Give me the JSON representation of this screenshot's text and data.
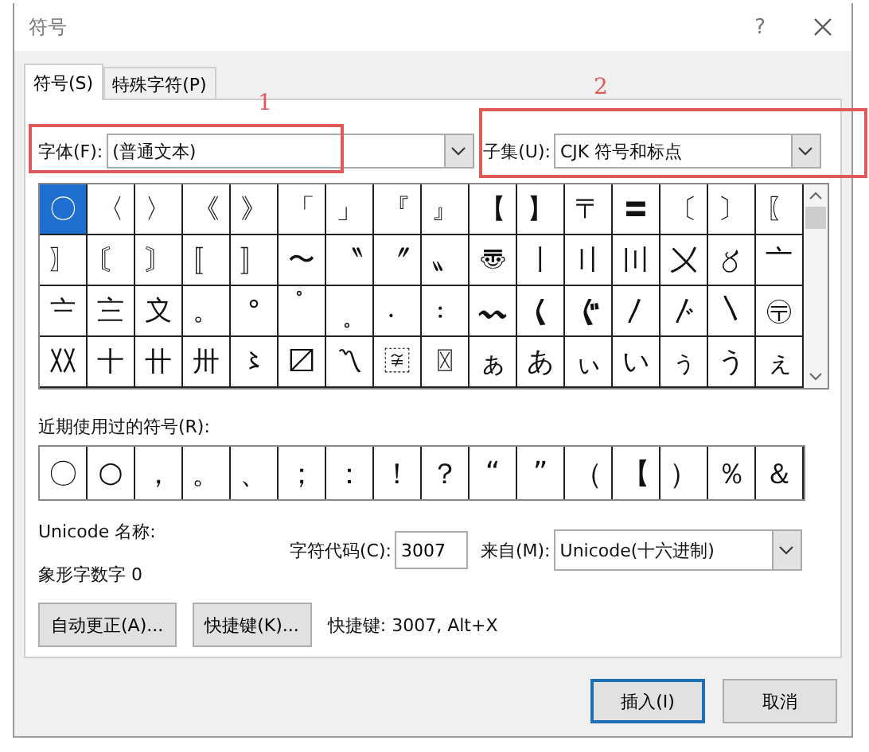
{
  "window": {
    "title": "符号",
    "help": "?"
  },
  "tabs": [
    {
      "label": "符号(S)",
      "selected": true
    },
    {
      "label": "特殊字符(P)",
      "selected": false
    }
  ],
  "font": {
    "label": "字体(F):",
    "value": "(普通文本)"
  },
  "subset": {
    "label": "子集(U):",
    "value": "CJK 符号和标点"
  },
  "annotations": [
    {
      "label": "1"
    },
    {
      "label": "2"
    }
  ],
  "symbols": [
    [
      {
        "c": "〇",
        "selected": true
      },
      {
        "c": "〈",
        "selected": false
      },
      {
        "c": "〉",
        "selected": false
      },
      {
        "c": "《",
        "selected": false
      },
      {
        "c": "》",
        "selected": false
      },
      {
        "c": "「",
        "selected": false
      },
      {
        "c": "」",
        "selected": false
      },
      {
        "c": "『",
        "selected": false
      },
      {
        "c": "』",
        "selected": false
      },
      {
        "c": "【",
        "selected": false
      },
      {
        "c": "】",
        "selected": false
      },
      {
        "c": "〒",
        "selected": false
      },
      {
        "c": "〓",
        "selected": false
      },
      {
        "c": "〔",
        "selected": false
      },
      {
        "c": "〕",
        "selected": false
      },
      {
        "c": "〖",
        "selected": false
      }
    ],
    [
      {
        "c": "〗",
        "selected": false
      },
      {
        "c": "〘",
        "selected": false
      },
      {
        "c": "〙",
        "selected": false
      },
      {
        "c": "〚",
        "selected": false
      },
      {
        "c": "〛",
        "selected": false
      },
      {
        "c": "〜",
        "selected": false
      },
      {
        "c": "〝",
        "selected": false
      },
      {
        "c": "〞",
        "selected": false
      },
      {
        "c": "〟",
        "selected": false
      },
      {
        "c": "〠",
        "selected": false
      },
      {
        "c": "〡",
        "selected": false
      },
      {
        "c": "〢",
        "selected": false
      },
      {
        "c": "〣",
        "selected": false
      },
      {
        "c": "〤",
        "selected": false
      },
      {
        "c": "〥",
        "selected": false
      },
      {
        "c": "〦",
        "selected": false
      }
    ],
    [
      {
        "c": "〧",
        "selected": false
      },
      {
        "c": "〨",
        "selected": false
      },
      {
        "c": "〩",
        "selected": false
      },
      {
        "c": "。",
        "selected": false
      },
      {
        "c": "°",
        "selected": false
      },
      {
        "c": "〬",
        "selected": false
      },
      {
        "c": "〭",
        "selected": false
      },
      {
        "c": "〮",
        "selected": false
      },
      {
        "c": "〯",
        "selected": false
      },
      {
        "c": "〰",
        "selected": false
      },
      {
        "c": "〱",
        "selected": false
      },
      {
        "c": "〲",
        "selected": false
      },
      {
        "c": "〳",
        "selected": false
      },
      {
        "c": "〴",
        "selected": false
      },
      {
        "c": "〵",
        "selected": false
      },
      {
        "c": "〶",
        "selected": false
      }
    ],
    [
      {
        "c": "〷",
        "selected": false
      },
      {
        "c": "〸",
        "selected": false
      },
      {
        "c": "〹",
        "selected": false
      },
      {
        "c": "〺",
        "selected": false
      },
      {
        "c": "〻",
        "selected": false
      },
      {
        "c": "〼",
        "selected": false
      },
      {
        "c": "〽",
        "selected": false
      },
      {
        "c": "〾",
        "selected": false
      },
      {
        "c": "〿",
        "selected": false
      },
      {
        "c": "ぁ",
        "selected": false
      },
      {
        "c": "あ",
        "selected": false
      },
      {
        "c": "ぃ",
        "selected": false
      },
      {
        "c": "い",
        "selected": false
      },
      {
        "c": "ぅ",
        "selected": false
      },
      {
        "c": "う",
        "selected": false
      },
      {
        "c": "ぇ",
        "selected": false
      }
    ]
  ],
  "recent": {
    "label": "近期使用过的符号(R):",
    "symbols": [
      "〇",
      "○",
      "，",
      "。",
      "、",
      "；",
      "：",
      "！",
      "？",
      "“",
      "”",
      "（",
      "【",
      "）",
      "％",
      "＆"
    ]
  },
  "unicode_name": "Unicode 名称:",
  "description": "象形字数字 0",
  "code": {
    "label": "字符代码(C):",
    "value": "3007"
  },
  "from": {
    "label": "来自(M):",
    "value": "Unicode(十六进制)"
  },
  "buttons": [
    {
      "label": "自动更正(A)..."
    },
    {
      "label": "快捷键(K)..."
    }
  ],
  "shortcut": "快捷键: 3007, Alt+X",
  "footer_buttons": [
    {
      "label": "插入(I)",
      "default": true
    },
    {
      "label": "取消",
      "default": false
    }
  ]
}
